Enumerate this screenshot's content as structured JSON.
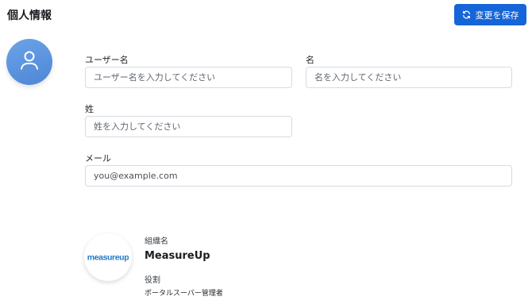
{
  "header": {
    "title": "個人情報",
    "save_label": "変更を保存",
    "save_icon": "refresh-icon"
  },
  "colors": {
    "primary": "#1565d8",
    "avatar": "#5b93de",
    "logo_blue": "#1f78c8"
  },
  "avatar": {
    "icon": "user-icon"
  },
  "form": {
    "username": {
      "label": "ユーザー名",
      "placeholder": "ユーザー名を入力してください",
      "value": ""
    },
    "first_name": {
      "label": "名",
      "placeholder": "名を入力してください",
      "value": ""
    },
    "last_name": {
      "label": "姓",
      "placeholder": "姓を入力してください",
      "value": ""
    },
    "email": {
      "label": "メール",
      "placeholder": "",
      "value": "you@example.com"
    }
  },
  "organization": {
    "logo_text": "measureup",
    "name_label": "組織名",
    "name": "MeasureUp",
    "role_label": "役割",
    "role": "ポータルスーパー管理者"
  }
}
